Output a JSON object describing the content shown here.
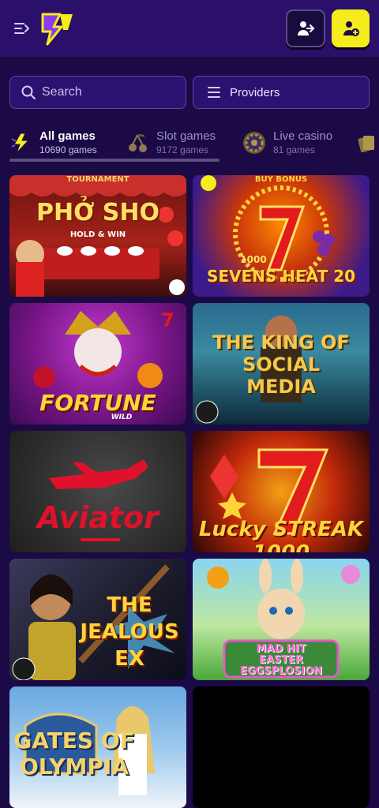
{
  "header": {
    "menu_icon": "collapse-menu-icon",
    "logo_icon": "lightning-logo-icon",
    "login_icon": "login-user-icon",
    "register_icon": "add-user-icon",
    "brand_color": "#2a0f6b",
    "accent_color": "#f5ec1c"
  },
  "search": {
    "placeholder": "Search",
    "icon": "search-icon"
  },
  "providers": {
    "label": "Providers",
    "icon": "hamburger-icon"
  },
  "tabs": [
    {
      "label": "All games",
      "count": "10690 games",
      "icon": "lightning-icon"
    },
    {
      "label": "Slot games",
      "count": "9172 games",
      "icon": "cherry-icon"
    },
    {
      "label": "Live casino",
      "count": "81 games",
      "icon": "roulette-icon"
    }
  ],
  "games": [
    {
      "title": "PHỞ SHO",
      "top": "TOURNAMENT",
      "badge": "HOLD & WIN"
    },
    {
      "title": "SEVENS HEAT 20",
      "top": "BUY BONUS",
      "badge": "1000"
    },
    {
      "title": "FORTUNE",
      "sub": "WILD"
    },
    {
      "title": "THE KING OF SOCIAL MEDIA"
    },
    {
      "title": "Aviator"
    },
    {
      "title": "Lucky STREAK 1000"
    },
    {
      "title": "THE JEALOUS EX"
    },
    {
      "title": "MAD HIT EASTER EGGSPLOSION"
    },
    {
      "title": "GATES OF OLYMPIA"
    },
    {
      "title": ""
    }
  ]
}
